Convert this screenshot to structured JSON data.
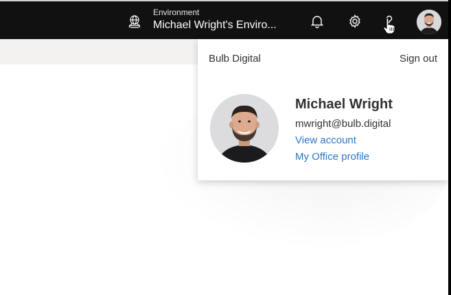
{
  "header": {
    "environment_label": "Environment",
    "environment_value": "Michael Wright's Enviro...",
    "icons": [
      "environment-icon",
      "bell-icon",
      "gear-icon",
      "help-icon",
      "avatar"
    ]
  },
  "account_panel": {
    "org_name": "Bulb Digital",
    "sign_out": "Sign out",
    "user_name": "Michael Wright",
    "email": "mwright@bulb.digital",
    "view_account": "View account",
    "office_profile": "My Office profile"
  },
  "colors": {
    "topbar": "#111112",
    "link": "#2b78c5",
    "text": "#323130",
    "subbar": "#f3f2f1"
  }
}
